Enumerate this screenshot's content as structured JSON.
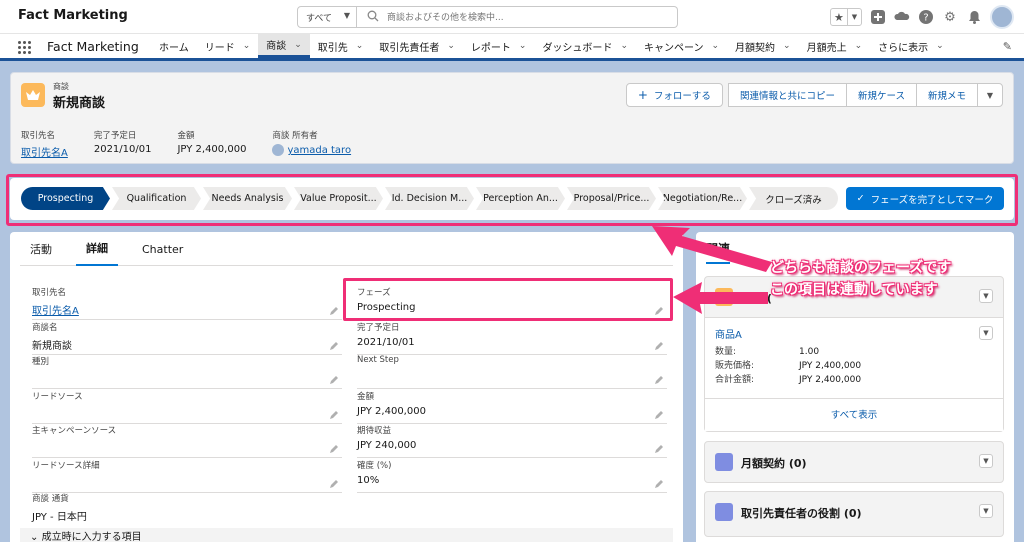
{
  "topbar": {
    "app_title": "Fact Marketing",
    "search_scope": "すべて",
    "search_placeholder": "商談およびその他を検索中..."
  },
  "nav": {
    "app_name": "Fact Marketing",
    "items": [
      {
        "label": "ホーム",
        "dropdown": false
      },
      {
        "label": "リード",
        "dropdown": true
      },
      {
        "label": "商談",
        "dropdown": true,
        "active": true
      },
      {
        "label": "取引先",
        "dropdown": true
      },
      {
        "label": "取引先責任者",
        "dropdown": true
      },
      {
        "label": "レポート",
        "dropdown": true
      },
      {
        "label": "ダッシュボード",
        "dropdown": true
      },
      {
        "label": "キャンペーン",
        "dropdown": true
      },
      {
        "label": "月額契約",
        "dropdown": true
      },
      {
        "label": "月額売上",
        "dropdown": true
      },
      {
        "label": "さらに表示",
        "dropdown": true
      }
    ]
  },
  "record": {
    "type": "商談",
    "name": "新規商談",
    "actions": {
      "follow": "フォローする",
      "copy": "関連情報と共にコピー",
      "new_case": "新規ケース",
      "new_memo": "新規メモ"
    },
    "highlights": [
      {
        "label": "取引先名",
        "value": "取引先名A",
        "link": true
      },
      {
        "label": "完了予定日",
        "value": "2021/10/01",
        "link": false
      },
      {
        "label": "金額",
        "value": "JPY 2,400,000",
        "link": false
      },
      {
        "label": "商談 所有者",
        "value": "yamada taro",
        "link": true
      }
    ]
  },
  "path": {
    "steps": [
      "Prospecting",
      "Qualification",
      "Needs Analysis",
      "Value Proposit...",
      "Id. Decision M...",
      "Perception An...",
      "Proposal/Price...",
      "Negotiation/Re...",
      "クローズ済み"
    ],
    "active_index": 0,
    "complete_button": "フェーズを完了としてマーク"
  },
  "detail": {
    "tabs": [
      "活動",
      "詳細",
      "Chatter"
    ],
    "active_tab": 1,
    "left_fields": [
      {
        "label": "取引先名",
        "value": "取引先名A",
        "link": true
      },
      {
        "label": "商談名",
        "value": "新規商談"
      },
      {
        "label": "種別",
        "value": ""
      },
      {
        "label": "リードソース",
        "value": ""
      },
      {
        "label": "主キャンペーンソース",
        "value": ""
      },
      {
        "label": "リードソース詳細",
        "value": ""
      },
      {
        "label": "商談 通貨",
        "value": "JPY - 日本円"
      }
    ],
    "right_fields": [
      {
        "label": "フェーズ",
        "value": "Prospecting"
      },
      {
        "label": "完了予定日",
        "value": "2021/10/01"
      },
      {
        "label": "Next Step",
        "value": ""
      },
      {
        "label": "金額",
        "value": "JPY 2,400,000"
      },
      {
        "label": "期待収益",
        "value": "JPY 240,000"
      },
      {
        "label": "確度 (%)",
        "value": "10%"
      }
    ],
    "section": "成立時に入力する項目"
  },
  "related": {
    "tab": "関連",
    "products": {
      "title": "商品 (",
      "item": "商品A",
      "rows": [
        {
          "k": "数量:",
          "v": "1.00"
        },
        {
          "k": "販売価格:",
          "v": "JPY 2,400,000"
        },
        {
          "k": "合計金額:",
          "v": "JPY 2,400,000"
        }
      ],
      "view_all": "すべて表示"
    },
    "monthly": {
      "title": "月額契約 (0)"
    },
    "contact_roles": {
      "title": "取引先責任者の役割 (0)"
    }
  },
  "annotation": {
    "line1": "どちらも商談のフェーズです",
    "line2": "この項目は連動しています"
  },
  "colors": {
    "accent": "#0176d3",
    "path_active": "#014486",
    "highlight": "#ef2e76",
    "opportunity_icon": "#fcb95b"
  }
}
